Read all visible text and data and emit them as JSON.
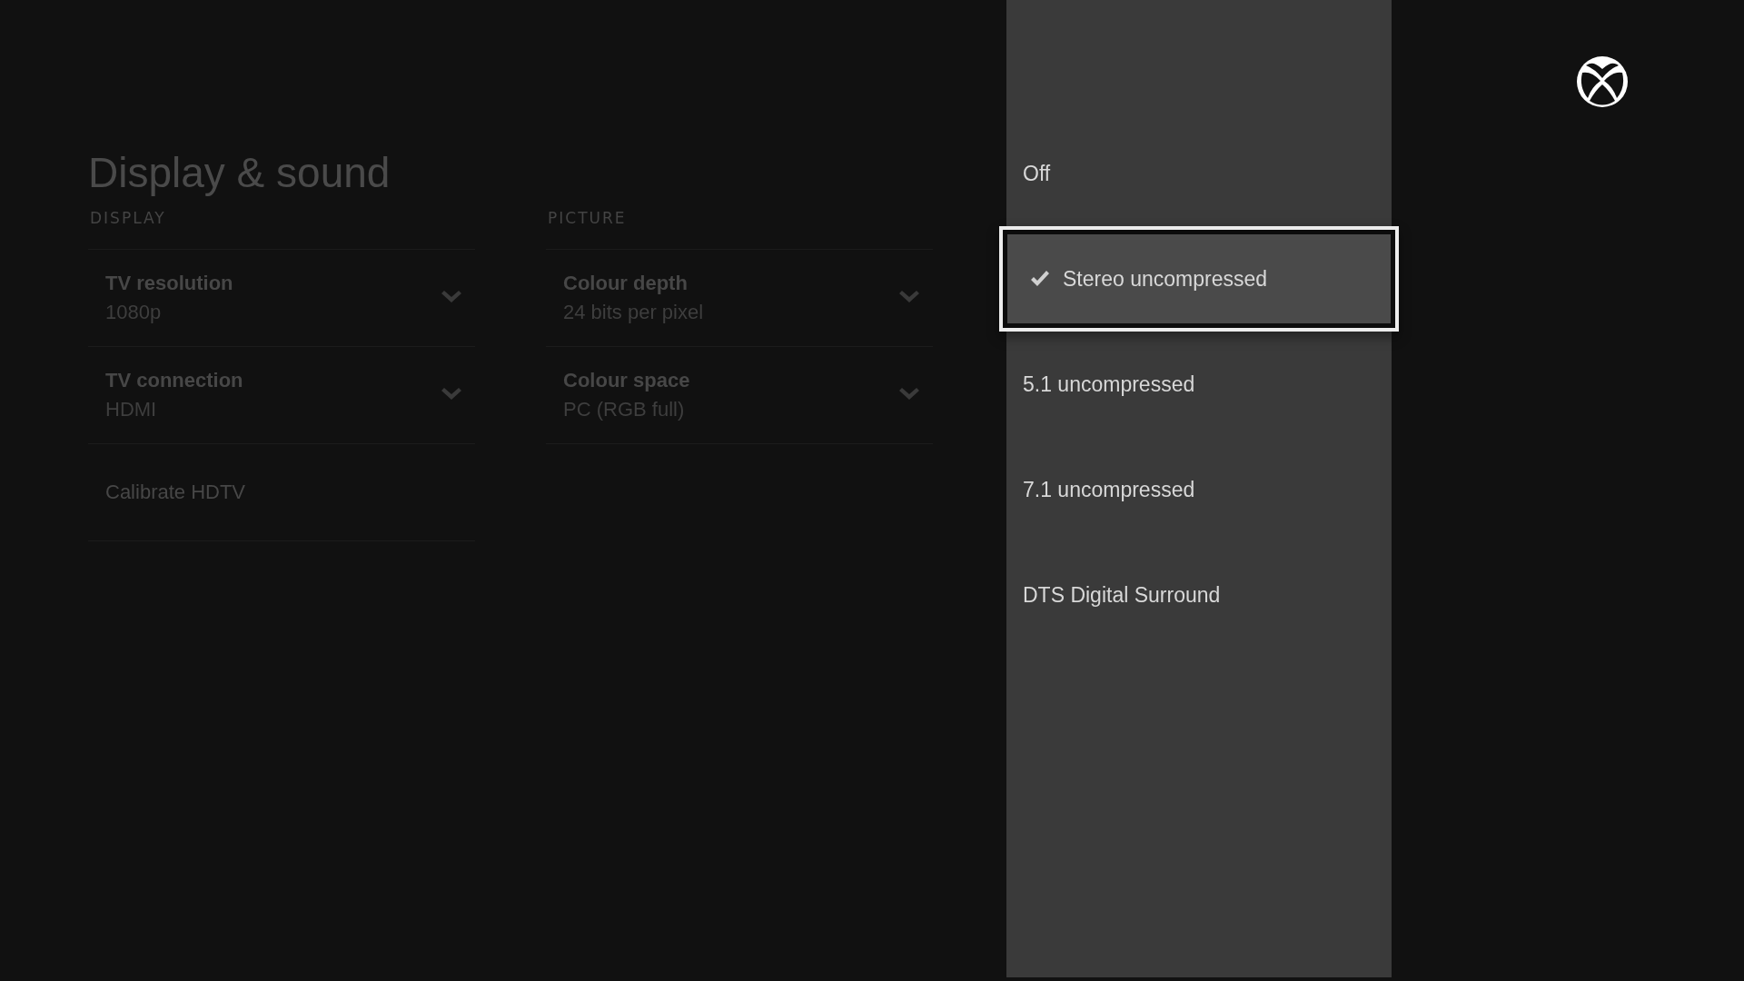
{
  "page": {
    "title": "Display & sound"
  },
  "sections": [
    {
      "heading": "DISPLAY",
      "items": [
        {
          "kind": "dropdown",
          "label": "TV resolution",
          "value": "1080p"
        },
        {
          "kind": "dropdown",
          "label": "TV connection",
          "value": "HDMI"
        },
        {
          "kind": "link",
          "label": "Calibrate HDTV"
        }
      ]
    },
    {
      "heading": "PICTURE",
      "items": [
        {
          "kind": "dropdown",
          "label": "Colour depth",
          "value": "24 bits per pixel"
        },
        {
          "kind": "dropdown",
          "label": "Colour space",
          "value": "PC (RGB full)"
        }
      ]
    }
  ],
  "options": [
    {
      "label": "Off",
      "checked": false,
      "focused": false
    },
    {
      "label": "Stereo uncompressed",
      "checked": true,
      "focused": true
    },
    {
      "label": "5.1 uncompressed",
      "checked": false,
      "focused": false
    },
    {
      "label": "7.1 uncompressed",
      "checked": false,
      "focused": false
    },
    {
      "label": "DTS Digital Surround",
      "checked": false,
      "focused": false
    }
  ]
}
